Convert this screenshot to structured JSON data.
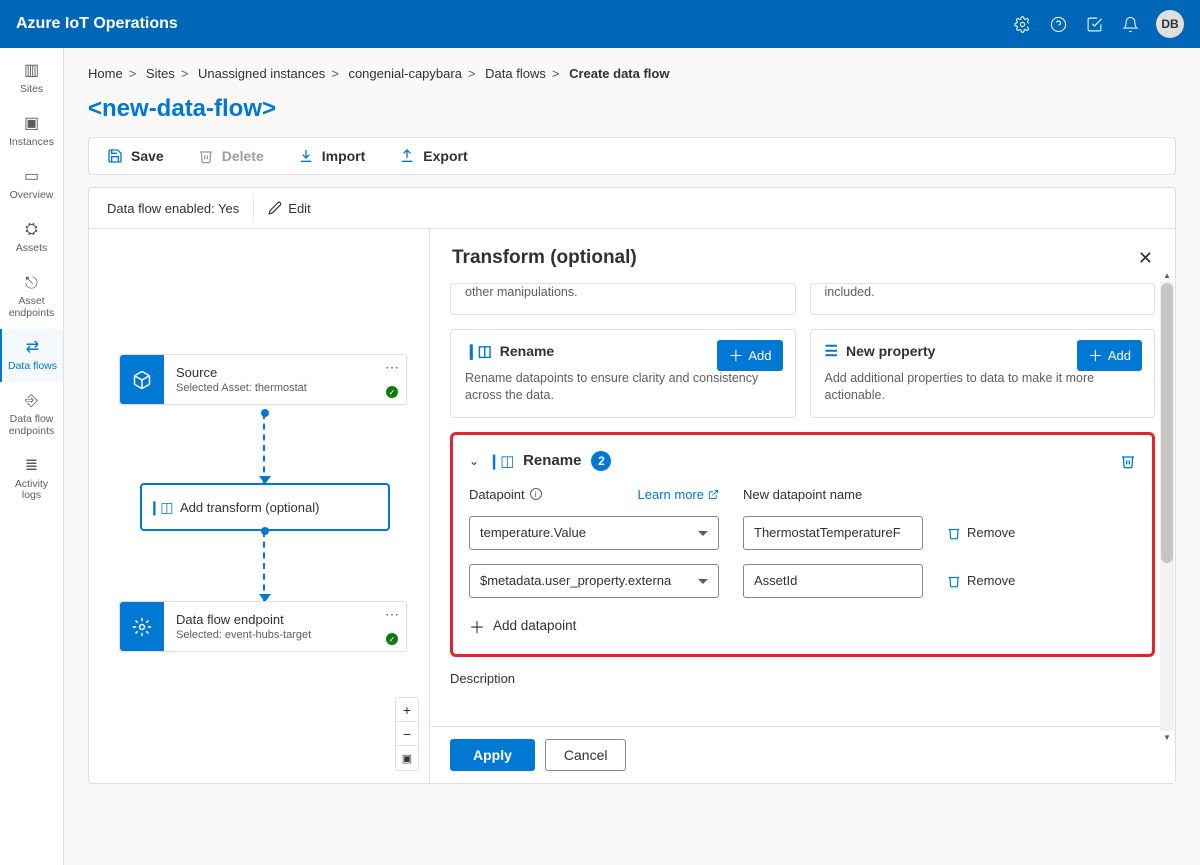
{
  "app_title": "Azure IoT Operations",
  "user_initials": "DB",
  "breadcrumb": [
    "Home",
    "Sites",
    "Unassigned instances",
    "congenial-capybara",
    "Data flows",
    "Create data flow"
  ],
  "page_title": "<new-data-flow>",
  "toolbar": {
    "save": "Save",
    "delete": "Delete",
    "import": "Import",
    "export": "Export"
  },
  "status": {
    "enabled_label": "Data flow enabled: Yes",
    "edit": "Edit"
  },
  "sidenav": {
    "items": [
      {
        "label": "Sites"
      },
      {
        "label": "Instances"
      },
      {
        "label": "Overview"
      },
      {
        "label": "Assets"
      },
      {
        "label": "Asset endpoints"
      },
      {
        "label": "Data flows"
      },
      {
        "label": "Data flow endpoints"
      },
      {
        "label": "Activity logs"
      }
    ]
  },
  "nodes": {
    "source": {
      "title": "Source",
      "sub": "Selected Asset: thermostat"
    },
    "transform": {
      "title": "Add transform (optional)"
    },
    "dest": {
      "title": "Data flow endpoint",
      "sub": "Selected: event-hubs-target"
    }
  },
  "panel": {
    "title": "Transform (optional)",
    "truncated1": "other manipulations.",
    "truncated2": "included.",
    "rename_card": {
      "title": "Rename",
      "desc": "Rename datapoints to ensure clarity and consistency across the data.",
      "add": "Add"
    },
    "newprop_card": {
      "title": "New property",
      "desc": "Add additional properties to data to make it more actionable.",
      "add": "Add"
    },
    "rename_section": {
      "title": "Rename",
      "count": "2",
      "datapoint_label": "Datapoint",
      "learn_more": "Learn more",
      "newname_label": "New datapoint name",
      "rows": [
        {
          "dp": "temperature.Value",
          "name": "ThermostatTemperatureF"
        },
        {
          "dp": "$metadata.user_property.externa",
          "name": "AssetId"
        }
      ],
      "remove": "Remove",
      "add_dp": "Add datapoint"
    },
    "description_label": "Description",
    "apply": "Apply",
    "cancel": "Cancel"
  }
}
